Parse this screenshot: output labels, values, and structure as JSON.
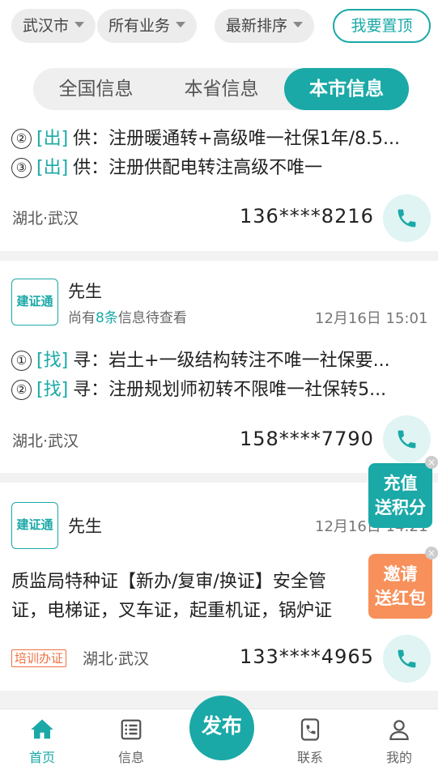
{
  "filters": [
    {
      "label": "武汉市"
    },
    {
      "label": "所有业务"
    },
    {
      "label": "最新排序"
    }
  ],
  "pin_button": "我要置顶",
  "tabs": [
    {
      "label": "全国信息",
      "active": false
    },
    {
      "label": "本省信息",
      "active": false
    },
    {
      "label": "本市信息",
      "active": true
    }
  ],
  "cards": [
    {
      "lines": [
        {
          "num": "②",
          "tag": "[出]",
          "text": "供：注册暖通转+高级唯一社保1年/8.5..."
        },
        {
          "num": "③",
          "tag": "[出]",
          "text": "供：注册供配电转注高级不唯一"
        }
      ],
      "location": "湖北·武汉",
      "phone": "136****8216"
    },
    {
      "badge": "建证通",
      "name": "先生",
      "pending_prefix": "尚有",
      "pending_count": "8条",
      "pending_suffix": "信息待查看",
      "time": "12月16日 15:01",
      "lines": [
        {
          "num": "①",
          "tag": "[找]",
          "text": "寻：岩土+一级结构转注不唯一社保要..."
        },
        {
          "num": "②",
          "tag": "[找]",
          "text": "寻：注册规划师初转不限唯一社保转5..."
        }
      ],
      "location": "湖北·武汉",
      "phone": "158****7790"
    },
    {
      "badge": "建证通",
      "name": "先生",
      "time": "12月16日 14:21",
      "body_line1": "质监局特种证【新办/复审/换证】安全管",
      "body_line2": "证，电梯证，叉车证，起重机证，锅炉证",
      "category_tag": "培训办证",
      "location": "湖北·武汉",
      "phone": "133****4965"
    }
  ],
  "promos": [
    {
      "line1": "充值",
      "line2": "送积分",
      "color": "#1aa9a7"
    },
    {
      "line1": "邀请",
      "line2": "送红包",
      "color": "#f7905a"
    }
  ],
  "bottom_nav": [
    {
      "label": "首页",
      "icon": "home-icon",
      "active": true
    },
    {
      "label": "信息",
      "icon": "list-icon",
      "active": false
    },
    {
      "label": "联系",
      "icon": "contact-phone-icon",
      "active": false
    },
    {
      "label": "我的",
      "icon": "user-icon",
      "active": false
    }
  ],
  "publish_button": "发布",
  "colors": {
    "accent": "#1aa9a7",
    "orange": "#f7905a"
  }
}
